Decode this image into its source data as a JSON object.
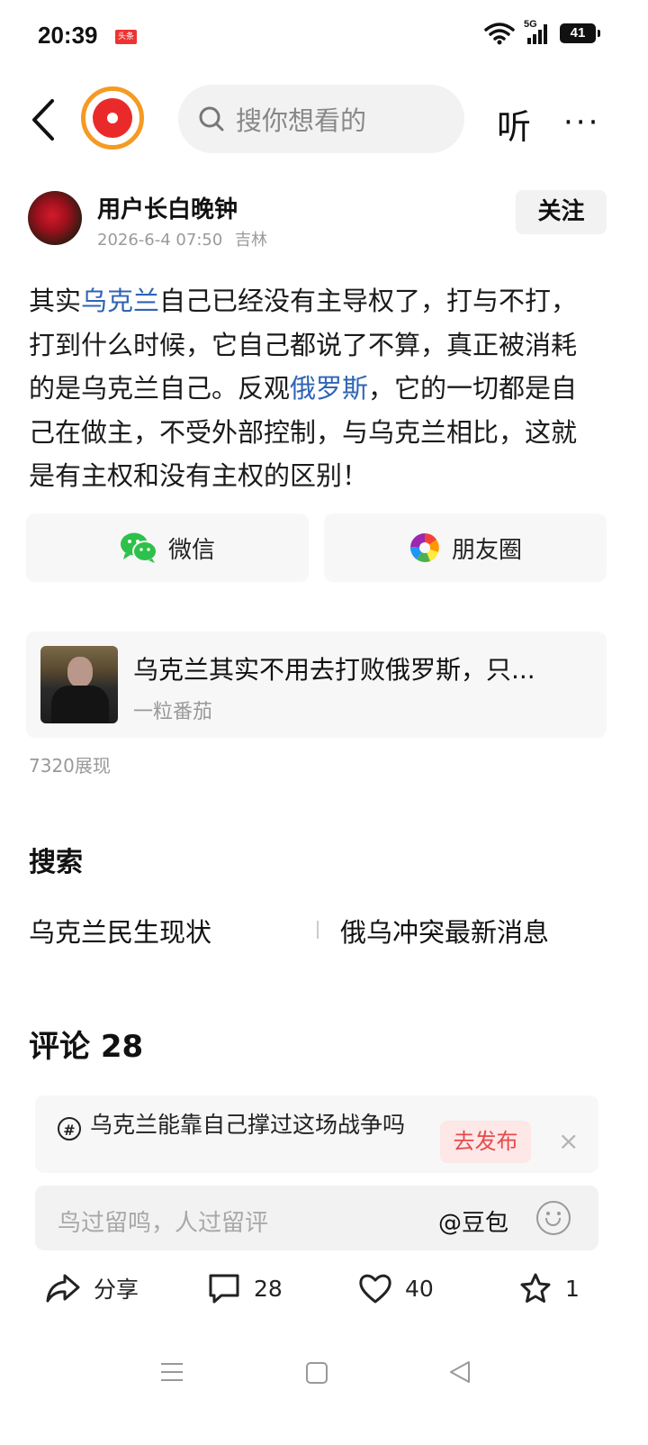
{
  "status_bar": {
    "time": "20:39",
    "app_badge": "头条",
    "network": "5G",
    "battery": "41"
  },
  "top_bar": {
    "search_placeholder": "搜你想看的",
    "listen_label": "听",
    "more_label": "···"
  },
  "author": {
    "name": "用户长白晚钟",
    "date": "2026-6-4 07:50",
    "location": "吉林",
    "follow_label": "关注"
  },
  "post": {
    "p1": "其实",
    "link1": "乌克兰",
    "p2": "自己已经没有主导权了，打与不打，打到什么时候，它自己都说了不算，真正被消耗的是乌克兰自己。反观",
    "link2": "俄罗斯",
    "p3": "，它的一切都是自己在做主，不受外部控制，与乌克兰相比，这就是有主权和没有主权的区别！"
  },
  "share": {
    "wechat_label": "微信",
    "moments_label": "朋友圈"
  },
  "related": {
    "title": "乌克兰其实不用去打败俄罗斯，只...",
    "author": "一粒番茄"
  },
  "views_text": "7320展现",
  "search_section": {
    "title": "搜索",
    "items": [
      "乌克兰民生现状",
      "俄乌冲突最新消息"
    ]
  },
  "comments": {
    "title": "评论 28"
  },
  "topic_prompt": {
    "text": "乌克兰能靠自己撑过这场战争吗",
    "publish_label": "去发布",
    "close_label": "×"
  },
  "comment_input": {
    "placeholder": "鸟过留鸣，人过留评",
    "mention_label": "@豆包"
  },
  "actions": {
    "share_label": "分享",
    "comment_count": "28",
    "like_count": "40",
    "favorite_count": "1"
  },
  "colors": {
    "link": "#2f64b5",
    "accent_red": "#e64b4b",
    "logo_orange": "#f59a23"
  }
}
